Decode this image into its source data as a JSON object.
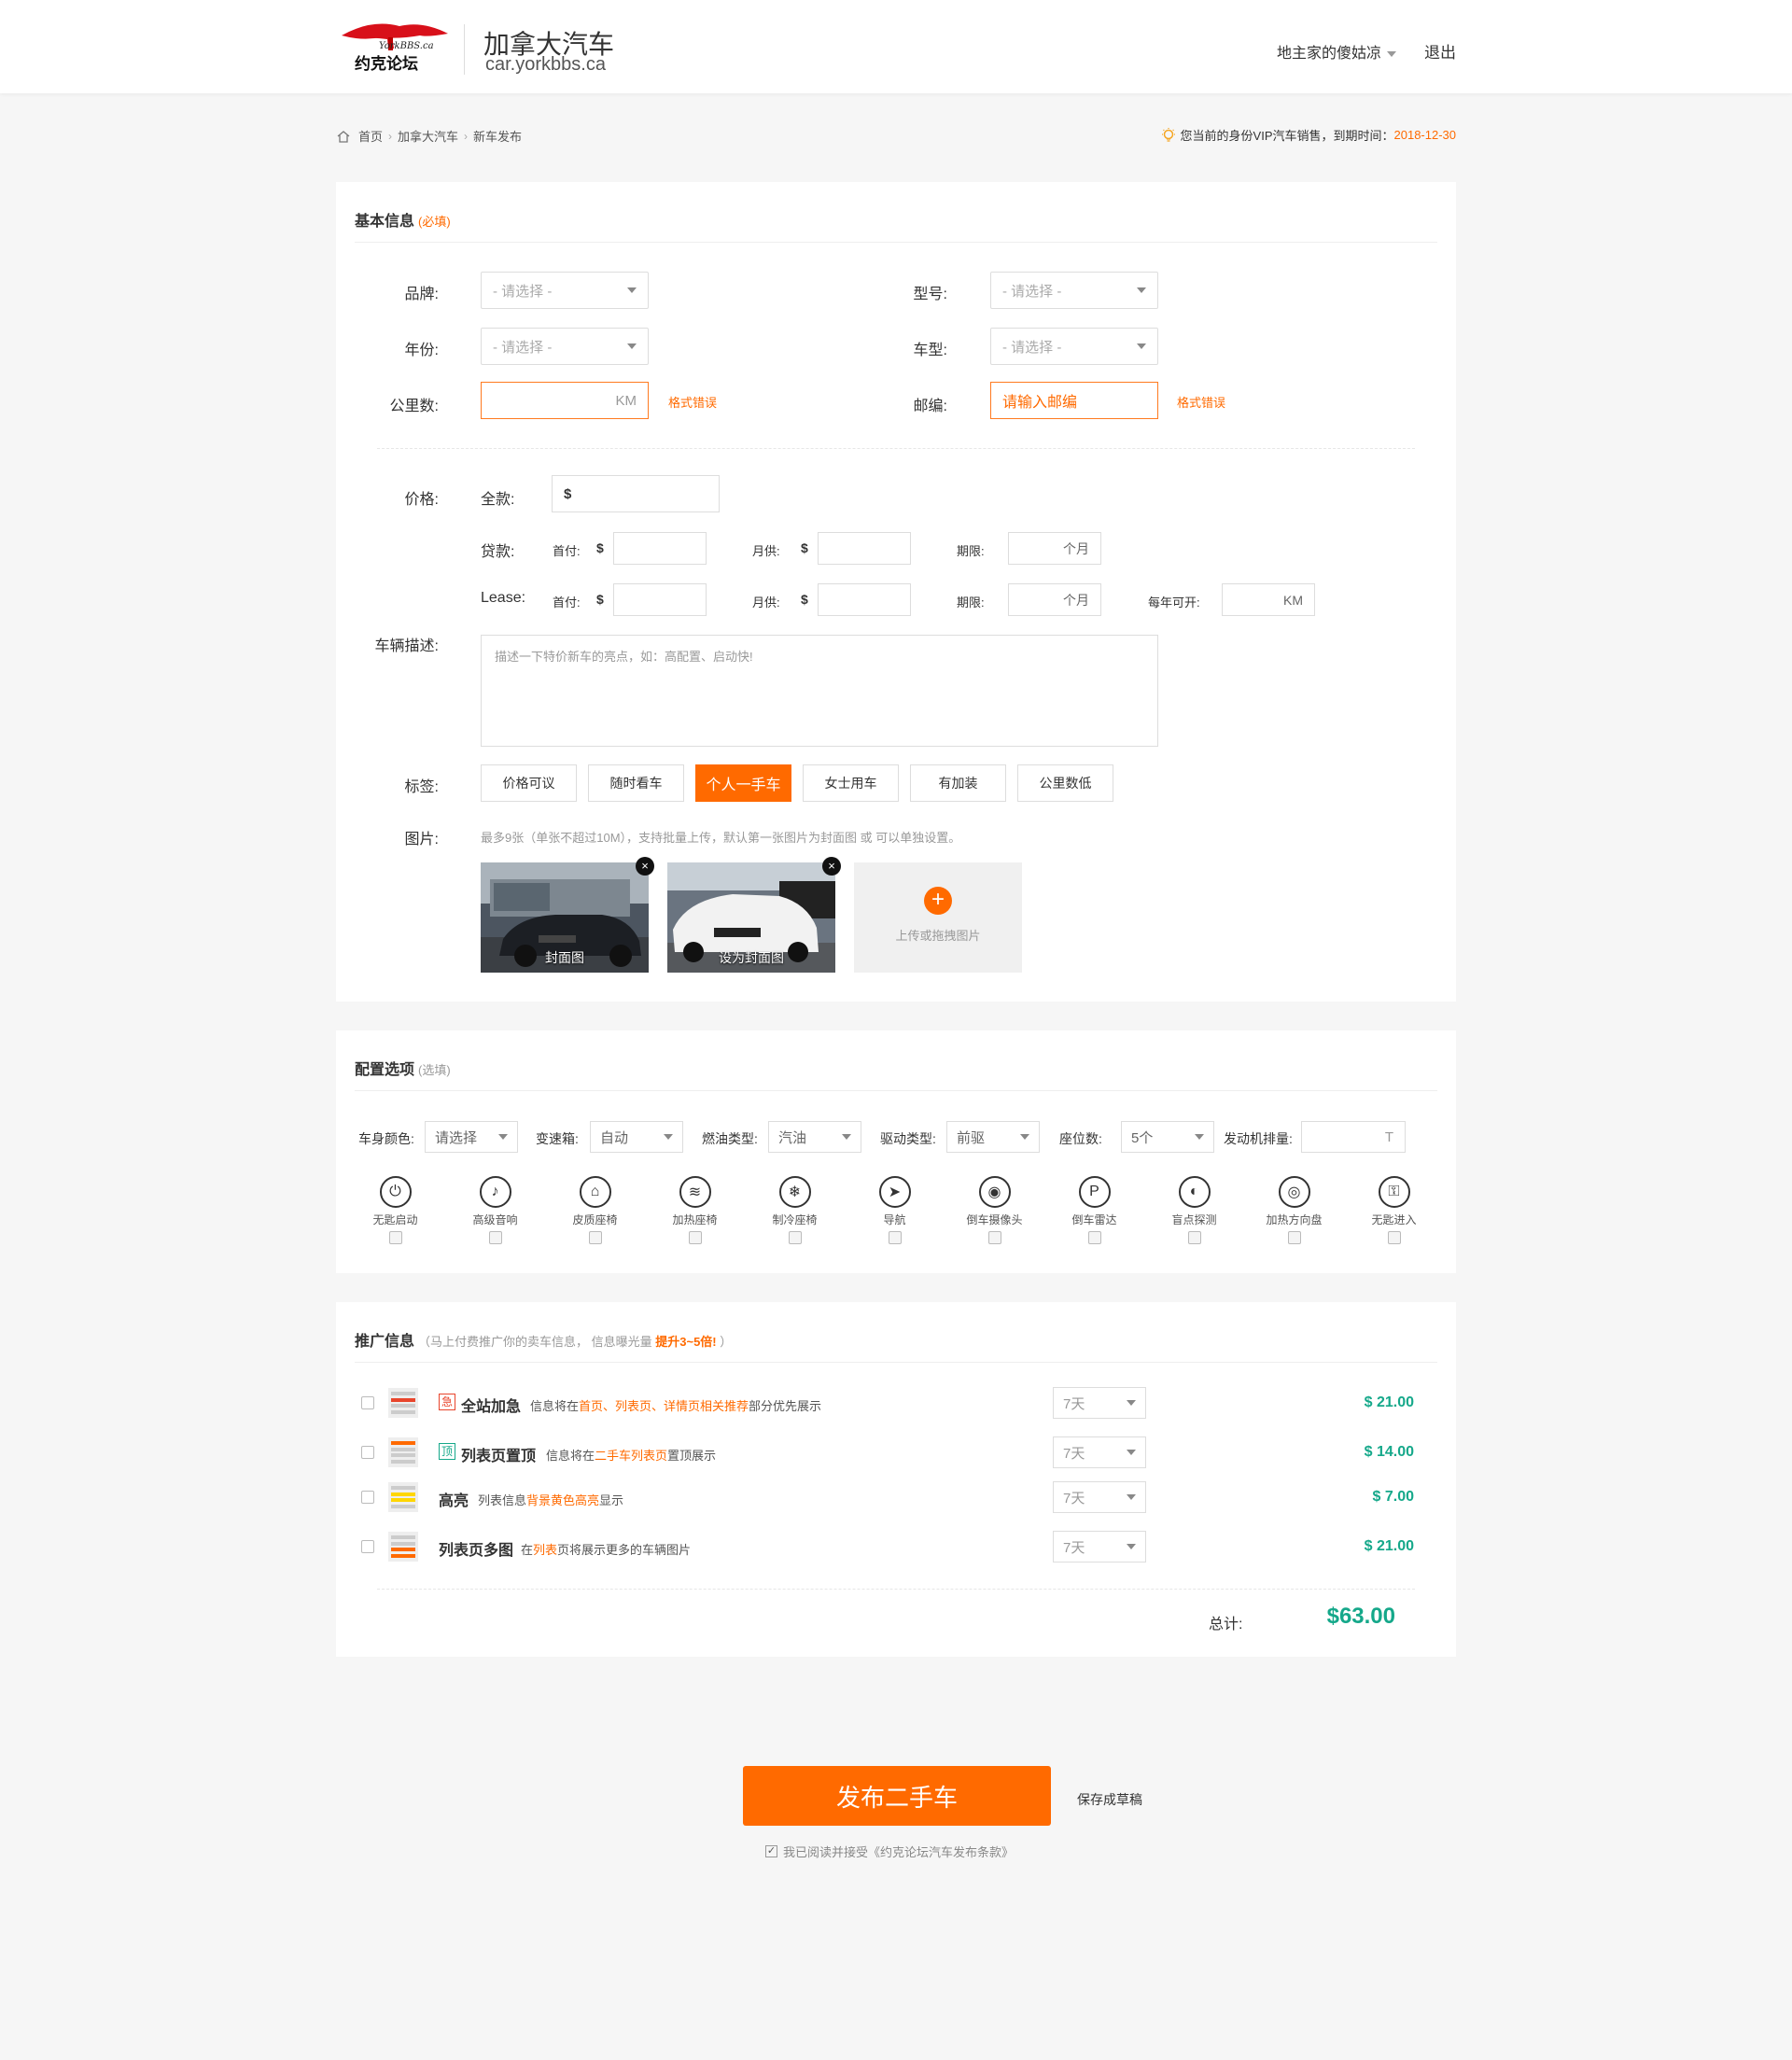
{
  "header": {
    "logo_text": "约克论坛",
    "logo_brand": "YorkBBS.ca",
    "site_title": "加拿大汽车",
    "site_url": "car.yorkbbs.ca",
    "user_name": "地主家的傻姑凉",
    "logout": "退出"
  },
  "breadcrumb": {
    "items": [
      "首页",
      "加拿大汽车",
      "新车发布"
    ],
    "sep": "›"
  },
  "vip_notice": {
    "text": "您当前的身份VIP汽车销售，到期时间：",
    "date": "2018-12-30"
  },
  "basic": {
    "title": "基本信息",
    "title_note": "(必填)",
    "brand_label": "品牌:",
    "model_label": "型号:",
    "year_label": "年份:",
    "type_label": "车型:",
    "mileage_label": "公里数:",
    "postcode_label": "邮编:",
    "select_placeholder": "- 请选择 -",
    "mileage_unit": "KM",
    "postcode_placeholder": "请输入邮编",
    "format_error": "格式错误",
    "price_label": "价格:",
    "full_label": "全款:",
    "dollar": "$",
    "loan_label": "贷款:",
    "lease_label": "Lease:",
    "down_label": "首付:",
    "monthly_label": "月供:",
    "term_label": "期限:",
    "term_unit": "个月",
    "yearly_km_label": "每年可开:",
    "km_unit": "KM",
    "desc_label": "车辆描述:",
    "desc_placeholder": "描述一下特价新车的亮点，如：高配置、启动快!",
    "tags_label": "标签:",
    "tags": [
      "价格可议",
      "随时看车",
      "个人一手车",
      "女士用车",
      "有加装",
      "公里数低"
    ],
    "active_tag": 2,
    "photos_label": "图片:",
    "photos_hint": "最多9张（单张不超过10M），支持批量上传，默认第一张图片为封面图 或 可以单独设置。",
    "photo1_caption": "封面图",
    "photo2_caption": "设为封面图",
    "upload_text": "上传或拖拽图片"
  },
  "config": {
    "title": "配置选项",
    "title_note": "(选填)",
    "color_label": "车身颜色:",
    "color_value": "请选择",
    "gearbox_label": "变速箱:",
    "gearbox_value": "自动",
    "fuel_label": "燃油类型:",
    "fuel_value": "汽油",
    "drive_label": "驱动类型:",
    "drive_value": "前驱",
    "seats_label": "座位数:",
    "seats_value": "5个",
    "engine_label": "发动机排量:",
    "engine_unit": "T",
    "features": [
      {
        "name": "无匙启动",
        "icon": "start-button-icon",
        "glyph": "⏻"
      },
      {
        "name": "高级音响",
        "icon": "speaker-icon",
        "glyph": "♪"
      },
      {
        "name": "皮质座椅",
        "icon": "leather-seat-icon",
        "glyph": "⌂"
      },
      {
        "name": "加热座椅",
        "icon": "heated-seat-icon",
        "glyph": "≋"
      },
      {
        "name": "制冷座椅",
        "icon": "cooled-seat-icon",
        "glyph": "❄"
      },
      {
        "name": "导航",
        "icon": "navigation-icon",
        "glyph": "➤"
      },
      {
        "name": "倒车摄像头",
        "icon": "camera-icon",
        "glyph": "◉"
      },
      {
        "name": "倒车雷达",
        "icon": "parking-radar-icon",
        "glyph": "P"
      },
      {
        "name": "盲点探测",
        "icon": "blind-spot-icon",
        "glyph": "◐"
      },
      {
        "name": "加热方向盘",
        "icon": "heated-wheel-icon",
        "glyph": "◎"
      },
      {
        "name": "无匙进入",
        "icon": "keyless-entry-icon",
        "glyph": "⚿"
      }
    ]
  },
  "promo": {
    "title": "推广信息",
    "note_a": "（马上付费推广你的卖车信息， 信息曝光量 ",
    "note_b": "提升3~5倍!",
    "note_c": " ）",
    "duration": "7天",
    "items": [
      {
        "badge": "急",
        "name": "全站加急",
        "desc_a": "信息将在",
        "desc_b": "首页、列表页、详情页相关推荐",
        "desc_c": "部分优先展示",
        "price": "$ 21.00"
      },
      {
        "badge": "顶",
        "name": "列表页置顶",
        "desc_a": "信息将在",
        "desc_b": "二手车列表页",
        "desc_c": "置顶展示",
        "price": "$ 14.00"
      },
      {
        "badge": "",
        "name": "高亮",
        "desc_a": "列表信息",
        "desc_b": "背景黄色高亮",
        "desc_c": "显示",
        "price": "$ 7.00"
      },
      {
        "badge": "",
        "name": "列表页多图",
        "desc_a": "在",
        "desc_b": "列表",
        "desc_c": "页将展示更多的车辆图片",
        "price": "$ 21.00"
      }
    ],
    "total_label": "总计:",
    "total_value": "$63.00"
  },
  "footer": {
    "submit": "发布二手车",
    "draft": "保存成草稿",
    "agree": "我已阅读并接受《约克论坛汽车发布条款》"
  },
  "colors": {
    "accent": "#ff6a00",
    "price_green": "#15a88a"
  }
}
